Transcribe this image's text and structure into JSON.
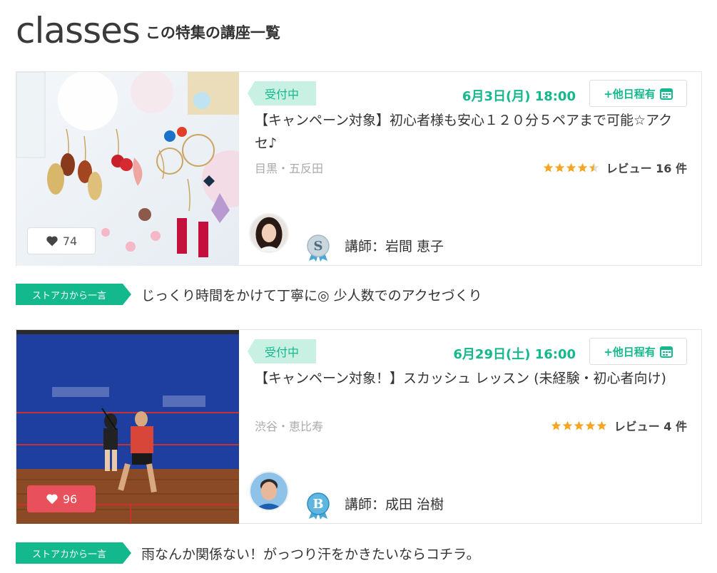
{
  "header": {
    "brand": "classes",
    "subtitle": "この特集の講座一覧"
  },
  "cards": [
    {
      "status": "受付中",
      "datetime": "6月3日(月) 18:00",
      "other_dates_label": "+他日程有",
      "title": "【キャンペーン対象】初心者様も安心１２０分５ペアまで可能☆アクセ♪",
      "area": "目黒・五反田",
      "rating": 4.5,
      "review_label": "レビュー 16 件",
      "likes": "74",
      "likes_active": false,
      "rank": "S",
      "instructor": "講師：岩間 恵子",
      "comment_tag": "ストアカから一言",
      "comment": "じっくり時間をかけて丁寧に◎ 少人数でのアクセづくり",
      "colors": {
        "likes_bg": "#ffffff"
      }
    },
    {
      "status": "受付中",
      "datetime": "6月29日(土) 16:00",
      "other_dates_label": "+他日程有",
      "title": "【キャンペーン対象！】スカッシュ レッスン (未経験・初心者向け)",
      "area": "渋谷・恵比寿",
      "rating": 5,
      "review_label": "レビュー 4 件",
      "likes": "96",
      "likes_active": true,
      "rank": "B",
      "instructor": "講師：成田 治樹",
      "comment_tag": "ストアカから一言",
      "comment": "雨なんか関係ない！がっつり汗をかきたいならコチラ。",
      "colors": {
        "likes_bg": "#e8505b"
      }
    }
  ],
  "colors": {
    "accent": "#13b88c",
    "status_bg": "#c8f0e3",
    "star": "#f5a623",
    "like_active": "#e8505b"
  }
}
